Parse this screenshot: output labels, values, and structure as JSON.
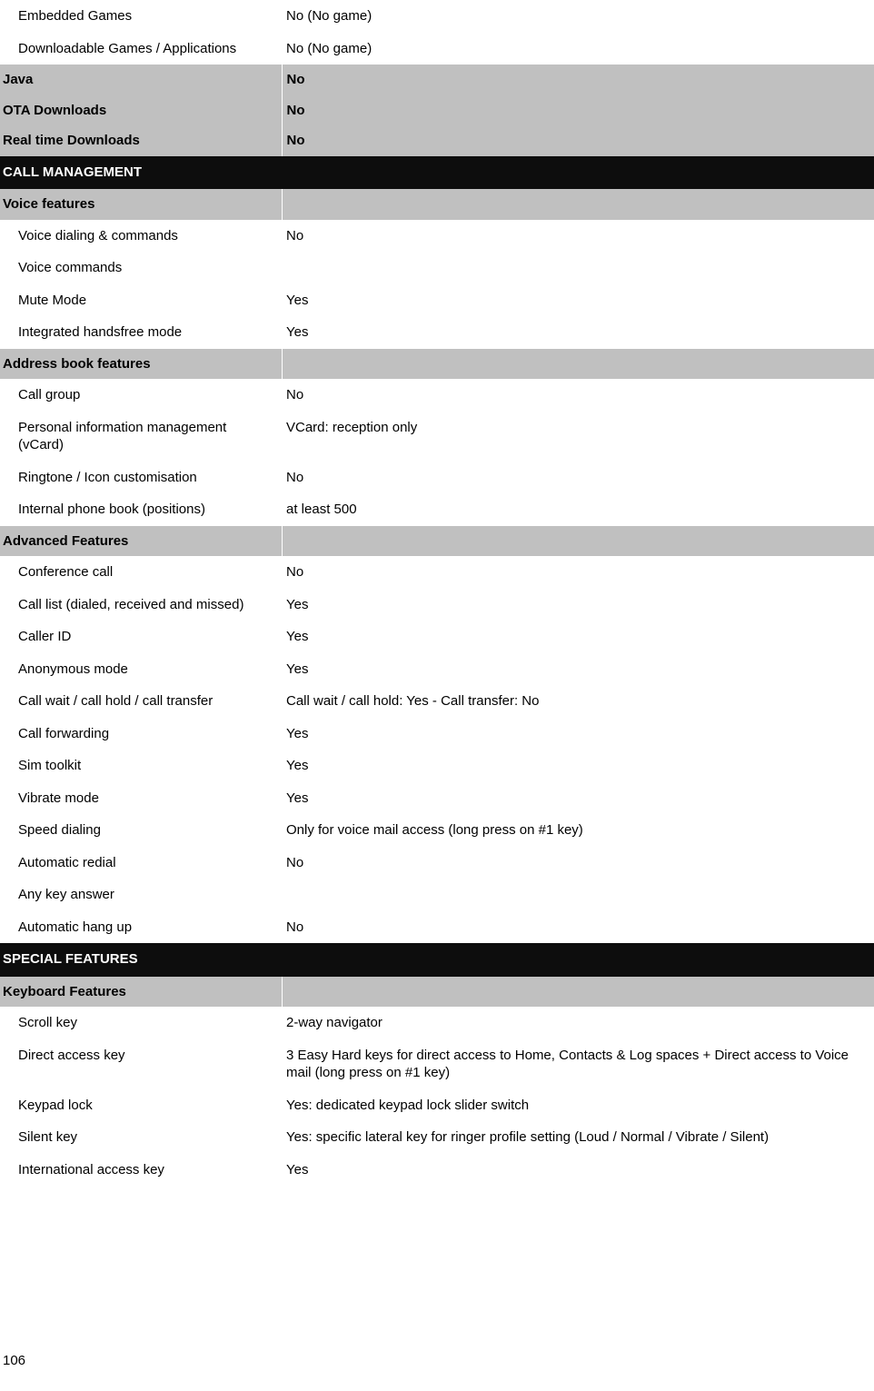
{
  "document": {
    "page_number": "106",
    "colors": {
      "page_background": "#ffffff",
      "group_row_background": "#c0c0c0",
      "section_row_background": "#0d0d0d",
      "section_row_text": "#ffffff",
      "body_text": "#000000"
    }
  },
  "table": {
    "rows": [
      {
        "kind": "detail",
        "label": "Embedded Games",
        "value": "No (No game)"
      },
      {
        "kind": "detail",
        "label": "Downloadable Games / Applications",
        "value": "No (No game)"
      },
      {
        "kind": "group",
        "label": "Java",
        "value": "No"
      },
      {
        "kind": "group",
        "label": "OTA Downloads",
        "value": "No"
      },
      {
        "kind": "group",
        "label": "Real time Downloads",
        "value": "No"
      },
      {
        "kind": "section",
        "label": "CALL MANAGEMENT",
        "value": ""
      },
      {
        "kind": "group",
        "label": "Voice features",
        "value": ""
      },
      {
        "kind": "detail",
        "label": "Voice dialing & commands",
        "value": "No"
      },
      {
        "kind": "detail",
        "label": "Voice commands",
        "value": ""
      },
      {
        "kind": "detail",
        "label": "Mute Mode",
        "value": "Yes"
      },
      {
        "kind": "detail",
        "label": "Integrated handsfree mode",
        "value": "Yes"
      },
      {
        "kind": "group",
        "label": "Address book features",
        "value": ""
      },
      {
        "kind": "detail",
        "label": "Call group",
        "value": "No"
      },
      {
        "kind": "detail",
        "label": "Personal information management (vCard)",
        "value": "VCard: reception only"
      },
      {
        "kind": "detail",
        "label": "Ringtone / Icon customisation",
        "value": "No"
      },
      {
        "kind": "detail",
        "label": "Internal phone book (positions)",
        "value": "at least 500"
      },
      {
        "kind": "group",
        "label": "Advanced Features",
        "value": ""
      },
      {
        "kind": "detail",
        "label": "Conference call",
        "value": "No"
      },
      {
        "kind": "detail",
        "label": "Call list (dialed, received and missed)",
        "value": "Yes"
      },
      {
        "kind": "detail",
        "label": "Caller ID",
        "value": "Yes"
      },
      {
        "kind": "detail",
        "label": "Anonymous mode",
        "value": "Yes"
      },
      {
        "kind": "detail",
        "label": "Call wait / call hold / call transfer",
        "value": "Call wait / call hold: Yes - Call transfer: No"
      },
      {
        "kind": "detail",
        "label": "Call forwarding",
        "value": "Yes"
      },
      {
        "kind": "detail",
        "label": "Sim toolkit",
        "value": "Yes"
      },
      {
        "kind": "detail",
        "label": "Vibrate mode",
        "value": "Yes"
      },
      {
        "kind": "detail",
        "label": "Speed dialing",
        "value": "Only for voice mail access (long press on #1 key)"
      },
      {
        "kind": "detail",
        "label": "Automatic redial",
        "value": "No"
      },
      {
        "kind": "detail",
        "label": "Any key answer",
        "value": ""
      },
      {
        "kind": "detail",
        "label": "Automatic hang up",
        "value": "No"
      },
      {
        "kind": "section",
        "label": "SPECIAL FEATURES",
        "value": ""
      },
      {
        "kind": "group",
        "label": "Keyboard Features",
        "value": ""
      },
      {
        "kind": "detail",
        "label": "Scroll key",
        "value": "2-way navigator"
      },
      {
        "kind": "detail",
        "label": "Direct access key",
        "value": "3 Easy Hard keys for direct access to Home, Contacts & Log spaces + Direct access to Voice mail (long press on #1 key)"
      },
      {
        "kind": "detail",
        "label": "Keypad lock",
        "value": "Yes: dedicated keypad lock slider switch"
      },
      {
        "kind": "detail",
        "label": "Silent key",
        "value": "Yes: specific lateral key for ringer profile setting (Loud / Normal / Vibrate / Silent)"
      },
      {
        "kind": "detail",
        "label": "International access key",
        "value": "Yes"
      }
    ]
  }
}
